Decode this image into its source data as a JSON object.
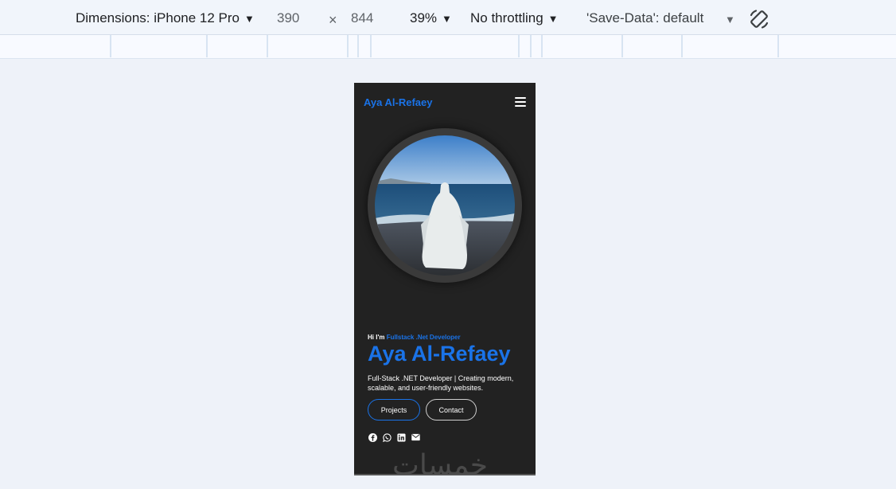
{
  "devtools": {
    "dimensions_label": "Dimensions: iPhone 12 Pro",
    "width": "390",
    "times": "×",
    "height": "844",
    "zoom": "39%",
    "throttling": "No throttling",
    "save_data": "'Save-Data': default"
  },
  "site": {
    "brand": "Aya Al-Refaey",
    "intro_prefix": "Hi I'm ",
    "intro_role": "Fullstack .Net Developer",
    "name": "Aya Al-Refaey",
    "description": "Full-Stack .NET Developer | Creating modern, scalable, and user-friendly websites.",
    "buttons": {
      "projects": "Projects",
      "contact": "Contact"
    },
    "socials": [
      "facebook-icon",
      "whatsapp-icon",
      "linkedin-icon",
      "email-icon"
    ],
    "watermark": "خمسات"
  },
  "colors": {
    "accent": "#1a73e8",
    "phone_bg": "#222222",
    "page_bg": "#eef2f9"
  }
}
